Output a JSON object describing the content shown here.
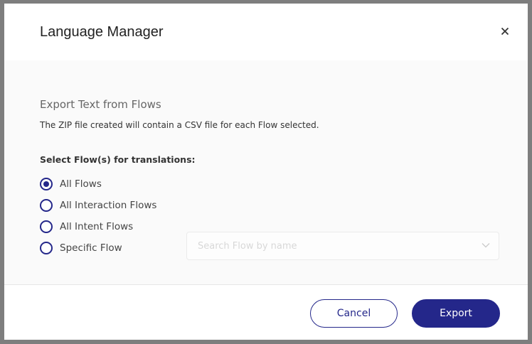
{
  "dialog": {
    "title": "Language Manager"
  },
  "export_section": {
    "title": "Export Text from Flows",
    "description": "The ZIP file created will contain a CSV file for each Flow selected.",
    "select_label": "Select Flow(s) for translations:"
  },
  "flow_options": [
    {
      "label": "All Flows",
      "checked": true
    },
    {
      "label": "All Interaction Flows",
      "checked": false
    },
    {
      "label": "All Intent Flows",
      "checked": false
    },
    {
      "label": "Specific Flow",
      "checked": false
    }
  ],
  "search": {
    "placeholder": "Search Flow by name"
  },
  "footer": {
    "cancel_label": "Cancel",
    "export_label": "Export"
  },
  "colors": {
    "accent": "#24278a",
    "frame": "#7e7e7e"
  }
}
